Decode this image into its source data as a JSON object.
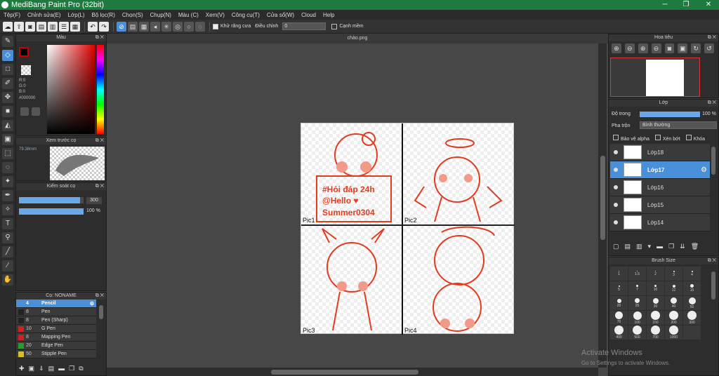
{
  "app": {
    "title": "MediBang Paint Pro (32bit)",
    "min": "─",
    "max": "❐",
    "close": "✕"
  },
  "menu": [
    "Tệp(F)",
    "Chỉnh sửa(E)",
    "Lớp(L)",
    "Bộ lọc(R)",
    "Chọn(S)",
    "Chụp(N)",
    "Màu (C)",
    "Xem(V)",
    "Công cụ(T)",
    "Cửa sổ(W)",
    "Cloud",
    "Help"
  ],
  "toolbar": {
    "antialias_label": "Khử răng cưa",
    "adjust_label": "Điều chỉnh",
    "adjust_value": "0",
    "edge_label": "Cạnh mềm",
    "antialias_checked": true
  },
  "color_panel": {
    "title": "Màu",
    "r": "R:0",
    "g": "G:0",
    "b": "B:0",
    "hex": "#000000",
    "primary": "#000000",
    "secondary": "#ffffff"
  },
  "preview_panel": {
    "title": "Xem trước cọ",
    "size": "79.38mm"
  },
  "brush_control": {
    "title": "Kiểm soát cọ",
    "size_value": "300",
    "opacity_value": "100 %",
    "size_fraction": 0.95,
    "opacity_fraction": 1.0
  },
  "brush_panel": {
    "title": "Cọ: NONAME",
    "items": [
      {
        "size": "4",
        "name": "Pencil",
        "color": "#4a90d9",
        "selected": true
      },
      {
        "size": "8",
        "name": "Pen",
        "color": "#222222",
        "selected": false
      },
      {
        "size": "8",
        "name": "Pen (Sharp)",
        "color": "#222222",
        "selected": false
      },
      {
        "size": "10",
        "name": "G Pen",
        "color": "#d02020",
        "selected": false
      },
      {
        "size": "8",
        "name": "Mapping Pen",
        "color": "#d02020",
        "selected": false
      },
      {
        "size": "20",
        "name": "Edge Pen",
        "color": "#2a9a2a",
        "selected": false
      },
      {
        "size": "50",
        "name": "Stipple Pen",
        "color": "#d8c020",
        "selected": false
      }
    ]
  },
  "canvas": {
    "tab": "chào.png"
  },
  "navigator": {
    "title": "Hoa tiêu"
  },
  "layers_panel": {
    "title": "Lớp",
    "opacity_label": "Độ trong",
    "opacity_value": "100 %",
    "opacity_fraction": 1.0,
    "blend_label": "Pha trộn",
    "blend_value": "Bình thường",
    "protect_alpha": "Bảo vệ alpha",
    "clipping": "Xén bớt",
    "lock": "Khóa",
    "layers": [
      {
        "name": "Lớp18",
        "selected": false
      },
      {
        "name": "Lớp17",
        "selected": true
      },
      {
        "name": "Lớp16",
        "selected": false
      },
      {
        "name": "Lớp15",
        "selected": false
      },
      {
        "name": "Lớp14",
        "selected": false
      }
    ]
  },
  "brush_size": {
    "title": "Brush Size",
    "sizes": [
      "1",
      "1.5",
      "2",
      "3",
      "4",
      "5",
      "7",
      "10",
      "12",
      "15",
      "20",
      "25",
      "30",
      "40",
      "50",
      "70",
      "100",
      "150",
      "200",
      "300",
      "400",
      "500",
      "700",
      "1000",
      ""
    ],
    "dots": [
      1,
      1,
      1,
      2,
      2,
      2,
      3,
      3,
      4,
      5,
      6,
      7,
      8,
      9,
      10,
      11,
      12,
      13,
      13,
      13,
      13,
      13,
      13,
      13,
      0
    ]
  },
  "watermark": {
    "line1": "Activate Windows",
    "line2": "Go to Settings to activate Windows."
  },
  "art_labels": [
    "Pic1",
    "Pic2",
    "Pic3",
    "Pic4"
  ],
  "art_sign": [
    "#Hỏi đáp 24h",
    "@Hello ♥",
    "Summer0304"
  ]
}
